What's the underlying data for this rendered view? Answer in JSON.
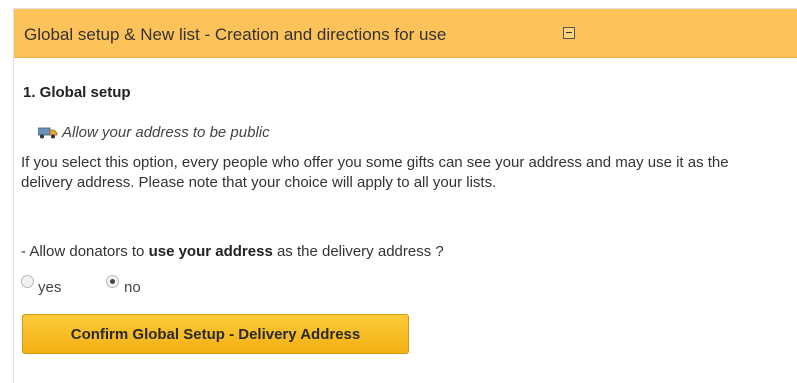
{
  "header": {
    "title": "Global setup & New list - Creation and directions for use",
    "collapse_icon": "collapse-icon"
  },
  "section": {
    "title": "1. Global setup",
    "option": {
      "icon": "delivery-truck-icon",
      "label": "Allow your address to be public"
    },
    "description": "If you select this option, every people who offer you some gifts can see your address and may use it as the delivery address. Please note that your choice will apply to all your lists.",
    "question": {
      "prefix": "- Allow donators to ",
      "bold": "use your address",
      "suffix": " as the delivery address ?"
    },
    "radios": [
      {
        "label": "yes",
        "checked": false
      },
      {
        "label": "no",
        "checked": true
      }
    ],
    "confirm_button": "Confirm Global Setup - Delivery Address"
  },
  "colors": {
    "header_bg": "#fdc35a",
    "button_bg": "#f7bb20"
  }
}
